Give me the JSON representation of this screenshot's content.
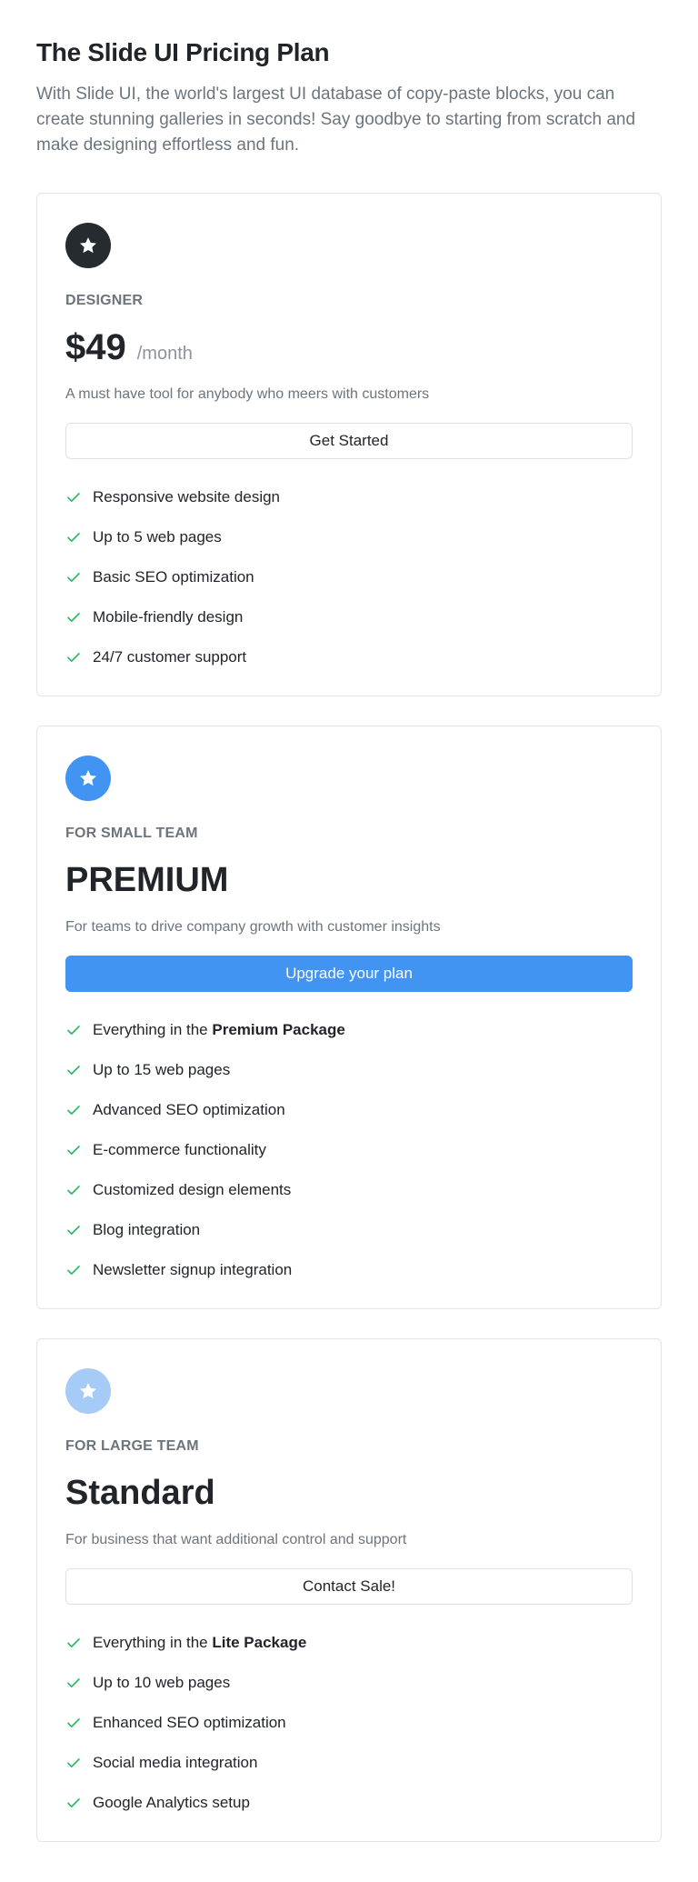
{
  "header": {
    "title": "The Slide UI Pricing Plan",
    "lead": "With Slide UI, the world's largest UI database of copy-paste blocks, you can create stunning galleries in seconds! Say goodbye to starting from scratch and make designing effortless and fun."
  },
  "colors": {
    "badge_dark": "#262b30",
    "badge_blue": "#4294f3",
    "badge_light": "#a7cbf7",
    "check_green": "#2eb865",
    "primary": "#4294f3"
  },
  "plans": [
    {
      "tier": "DESIGNER",
      "price": "$49",
      "period": "/month",
      "description": "A must have tool for anybody who meers with customers",
      "button": "Get Started",
      "icon": "star-icon",
      "features": [
        "Responsive website design",
        "Up to 5 web pages",
        "Basic SEO optimization",
        "Mobile-friendly design",
        "24/7 customer support"
      ]
    },
    {
      "tier": "FOR SMALL TEAM",
      "name": "PREMIUM",
      "description": "For teams to drive company growth with customer insights",
      "button": "Upgrade your plan",
      "icon": "star-icon",
      "features_first_prefix": "Everything in the ",
      "features_first_bold": "Premium Package",
      "features": [
        "Up to 15 web pages",
        "Advanced SEO optimization",
        "E-commerce functionality",
        "Customized design elements",
        "Blog integration",
        "Newsletter signup integration"
      ]
    },
    {
      "tier": "FOR LARGE TEAM",
      "name": "Standard",
      "description": "For business that want additional control and support",
      "button": "Contact Sale!",
      "icon": "star-icon",
      "features_first_prefix": "Everything in the ",
      "features_first_bold": "Lite Package",
      "features": [
        "Up to 10 web pages",
        "Enhanced SEO optimization",
        "Social media integration",
        "Google Analytics setup"
      ]
    }
  ]
}
